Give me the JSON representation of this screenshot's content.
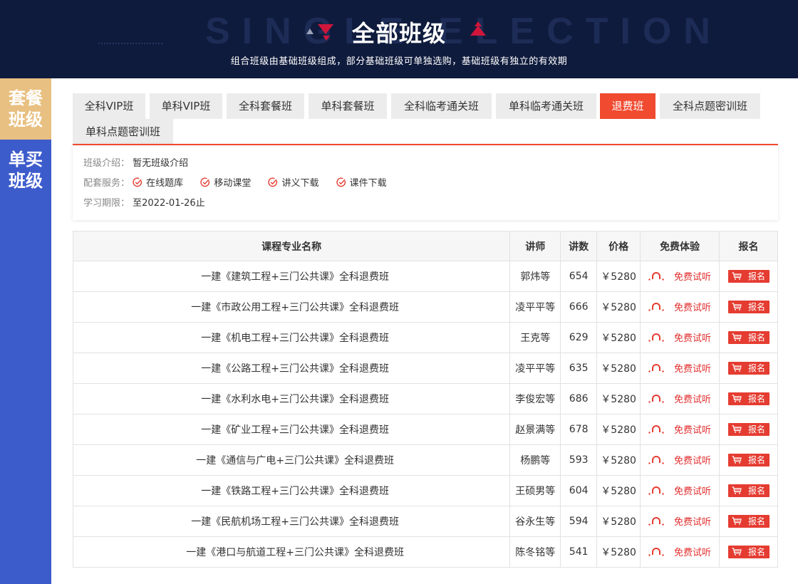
{
  "banner": {
    "bg_text": "SINGLE ELECTION",
    "title": "全部班级",
    "subtitle": "组合班级由基础班级组成，部分基础班级可单独选购，基础班级有独立的有效期"
  },
  "sidebar": {
    "items": [
      {
        "line1": "套餐",
        "line2": "班级",
        "active": true
      },
      {
        "line1": "单买",
        "line2": "班级",
        "active": false
      }
    ]
  },
  "tabs": [
    {
      "label": "全科VIP班",
      "active": false
    },
    {
      "label": "单科VIP班",
      "active": false
    },
    {
      "label": "全科套餐班",
      "active": false
    },
    {
      "label": "单科套餐班",
      "active": false
    },
    {
      "label": "全科临考通关班",
      "active": false
    },
    {
      "label": "单科临考通关班",
      "active": false
    },
    {
      "label": "退费班",
      "active": true
    },
    {
      "label": "全科点题密训班",
      "active": false
    },
    {
      "label": "单科点题密训班",
      "active": false
    }
  ],
  "info": {
    "intro_label": "班级介绍：",
    "intro_value": "暂无班级介绍",
    "services_label": "配套服务：",
    "services": [
      "在线题库",
      "移动课堂",
      "讲义下载",
      "课件下载"
    ],
    "period_label": "学习期限：",
    "period_value": "至2022-01-26止"
  },
  "table": {
    "headers": {
      "name": "课程专业名称",
      "teacher": "讲师",
      "lectures": "讲数",
      "price": "价格",
      "trial": "免费体验",
      "enroll": "报名"
    },
    "trial_label": "免费试听",
    "enroll_label": "报名",
    "rows": [
      {
        "name": "一建《建筑工程+三门公共课》全科退费班",
        "teacher": "郭炜等",
        "lectures": "654",
        "price": "￥5280"
      },
      {
        "name": "一建《市政公用工程+三门公共课》全科退费班",
        "teacher": "凌平平等",
        "lectures": "666",
        "price": "￥5280"
      },
      {
        "name": "一建《机电工程+三门公共课》全科退费班",
        "teacher": "王克等",
        "lectures": "629",
        "price": "￥5280"
      },
      {
        "name": "一建《公路工程+三门公共课》全科退费班",
        "teacher": "凌平平等",
        "lectures": "635",
        "price": "￥5280"
      },
      {
        "name": "一建《水利水电+三门公共课》全科退费班",
        "teacher": "李俊宏等",
        "lectures": "686",
        "price": "￥5280"
      },
      {
        "name": "一建《矿业工程+三门公共课》全科退费班",
        "teacher": "赵景满等",
        "lectures": "678",
        "price": "￥5280"
      },
      {
        "name": "一建《通信与广电+三门公共课》全科退费班",
        "teacher": "杨鹏等",
        "lectures": "593",
        "price": "￥5280"
      },
      {
        "name": "一建《铁路工程+三门公共课》全科退费班",
        "teacher": "王硕男等",
        "lectures": "604",
        "price": "￥5280"
      },
      {
        "name": "一建《民航机场工程+三门公共课》全科退费班",
        "teacher": "谷永生等",
        "lectures": "594",
        "price": "￥5280"
      },
      {
        "name": "一建《港口与航道工程+三门公共课》全科退费班",
        "teacher": "陈冬铭等",
        "lectures": "541",
        "price": "￥5280"
      }
    ]
  },
  "colors": {
    "banner_bg": "#0f1b3d",
    "sidebar_bg": "#3d5ccc",
    "sidebar_active": "#e8c081",
    "accent": "#f04a30",
    "price": "#e22e2e"
  }
}
